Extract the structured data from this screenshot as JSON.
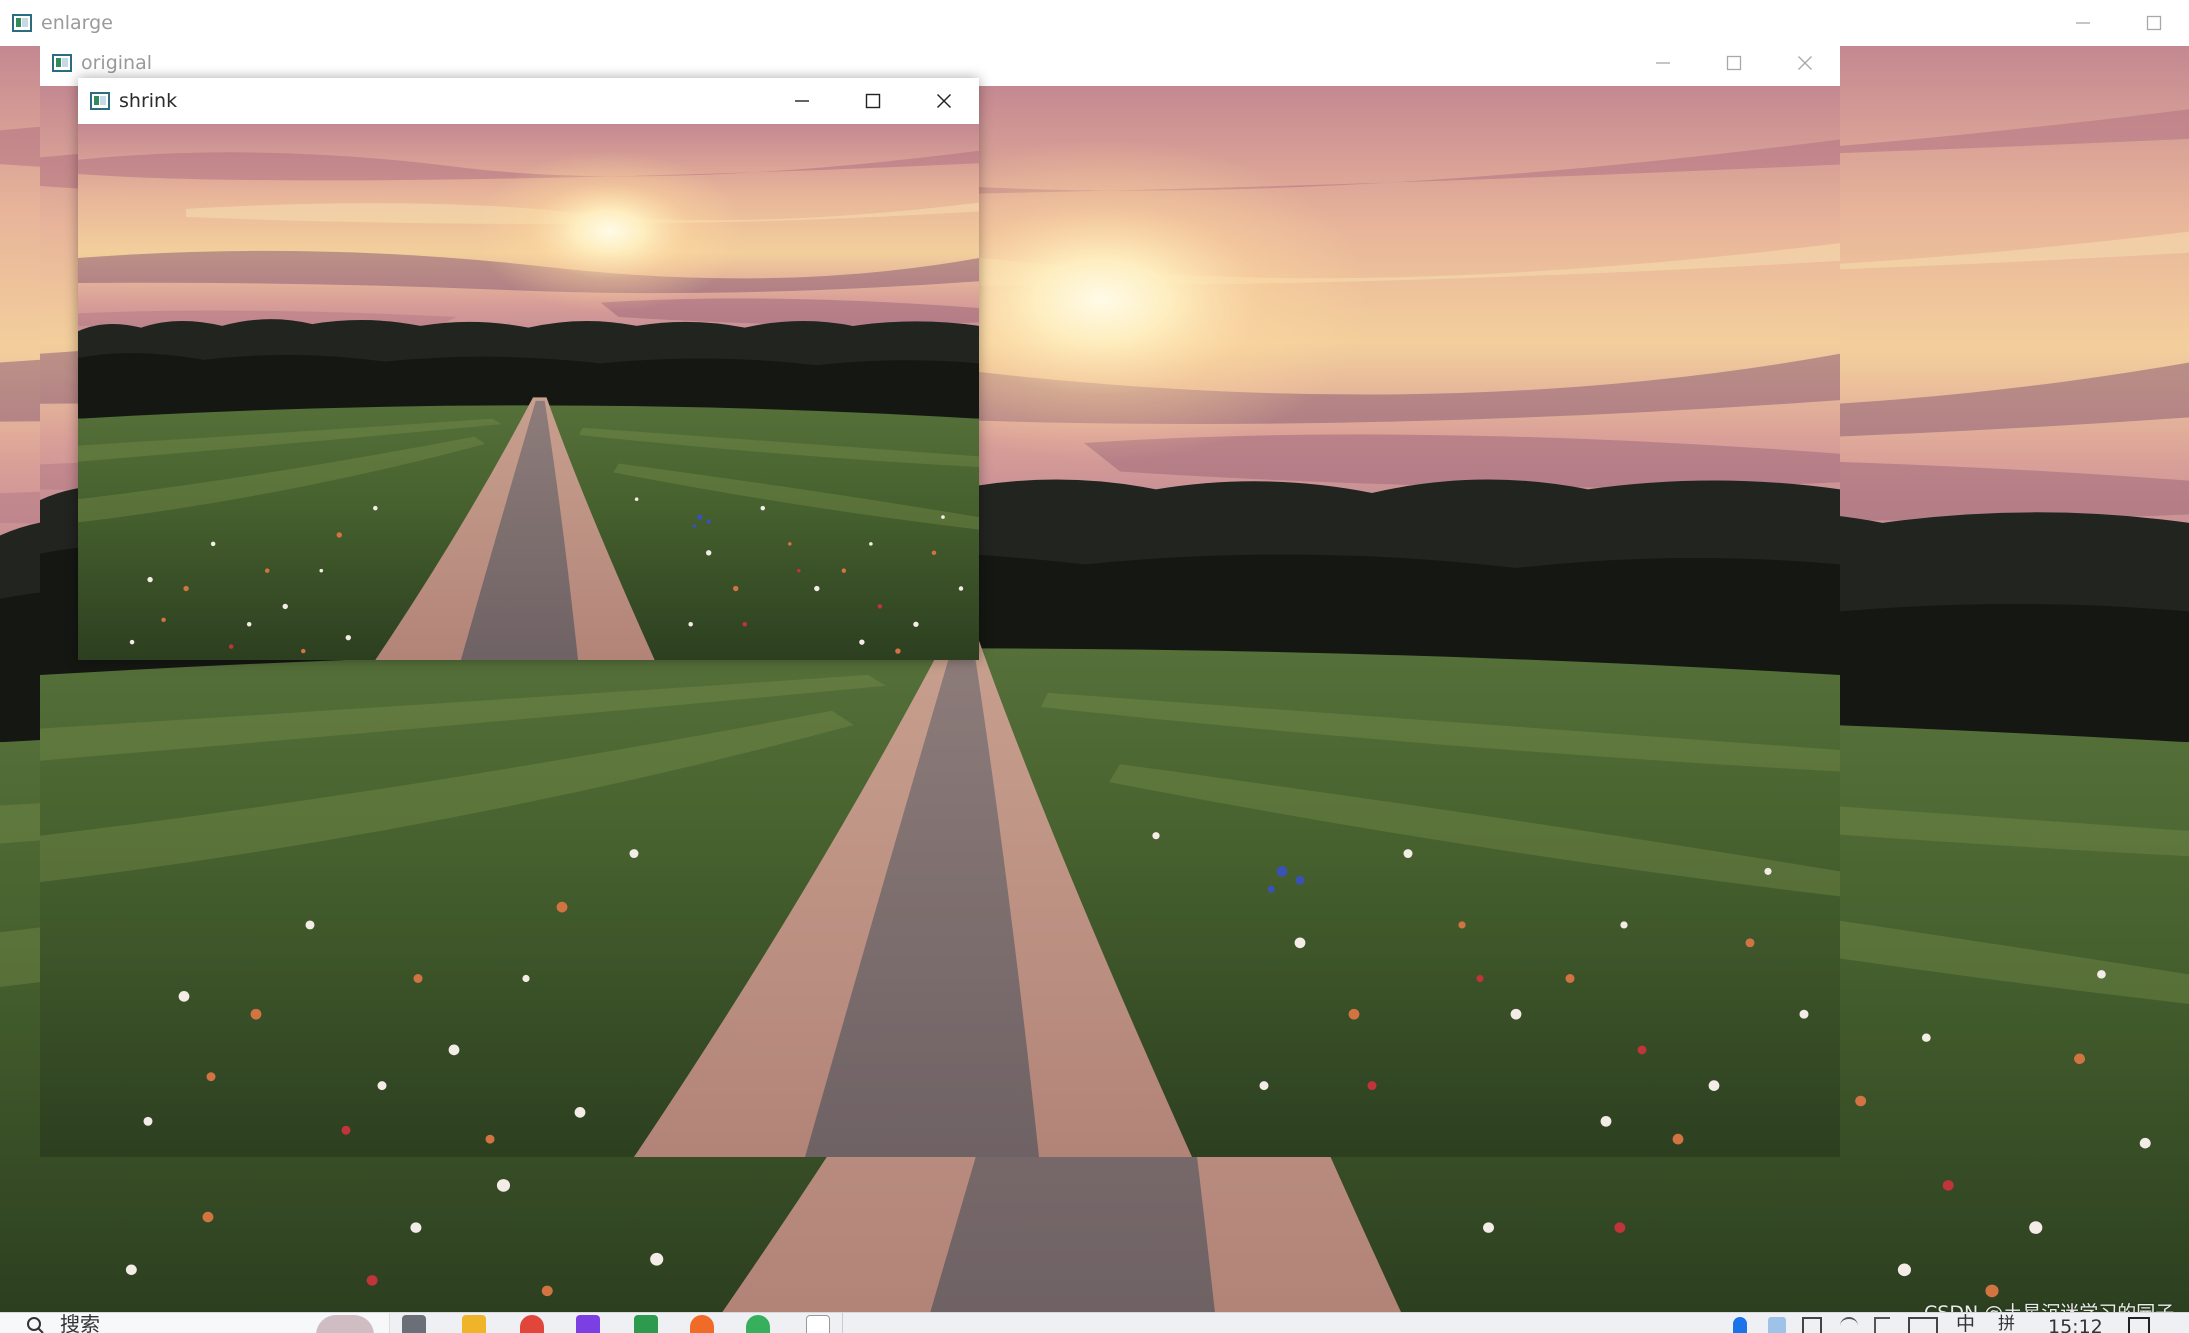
{
  "windows": {
    "enlarge": {
      "title": "enlarge"
    },
    "original": {
      "title": "original"
    },
    "shrink": {
      "title": "shrink"
    }
  },
  "taskbar": {
    "search_text": "搜索",
    "tray_input_method": "中",
    "tray_input_mode": "拼",
    "clock": "15:12"
  },
  "watermark": "CSDN @土星沉迷学习的园子",
  "colors": {
    "sky_top": "#c98f96",
    "sky_glow": "#f6d59c",
    "sun": "#fff5dc",
    "tree_line": "#1b1d19",
    "grass": "#3d5a2b",
    "path": "#b98e82",
    "taskbar": "#eef0f4"
  },
  "icons": [
    "app-window-icon",
    "minimize-icon",
    "maximize-icon",
    "close-icon",
    "search-icon",
    "bluetooth-icon",
    "network-icon",
    "volume-icon",
    "keyboard-icon",
    "notification-icon"
  ]
}
